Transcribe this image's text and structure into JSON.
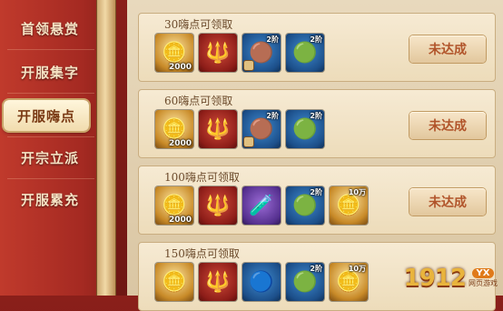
{
  "sidebar": {
    "items": [
      {
        "label": "首领悬赏",
        "active": false
      },
      {
        "label": "开服集字",
        "active": false
      },
      {
        "label": "开服嗨点",
        "active": true
      },
      {
        "label": "开宗立派",
        "active": false
      },
      {
        "label": "开服累充",
        "active": false
      }
    ]
  },
  "rewards": [
    {
      "title": "30嗨点可领取",
      "button": "未达成",
      "items": [
        {
          "icon": "gold-ingot-icon",
          "qty": "2000",
          "tier": ""
        },
        {
          "icon": "staff-icon",
          "qty": "",
          "tier": ""
        },
        {
          "icon": "bronze-orb-icon",
          "qty": "",
          "tier": "2阶"
        },
        {
          "icon": "green-orb-icon",
          "qty": "",
          "tier": "2阶"
        }
      ]
    },
    {
      "title": "60嗨点可领取",
      "button": "未达成",
      "items": [
        {
          "icon": "gold-ingot-icon",
          "qty": "2000",
          "tier": ""
        },
        {
          "icon": "staff-icon",
          "qty": "",
          "tier": ""
        },
        {
          "icon": "bronze-orb-icon",
          "qty": "",
          "tier": "2阶"
        },
        {
          "icon": "green-orb-icon",
          "qty": "",
          "tier": "2阶"
        }
      ]
    },
    {
      "title": "100嗨点可领取",
      "button": "未达成",
      "items": [
        {
          "icon": "gold-ingot-icon",
          "qty": "2000",
          "tier": ""
        },
        {
          "icon": "staff-icon",
          "qty": "",
          "tier": ""
        },
        {
          "icon": "potion-bottle-icon",
          "qty": "",
          "tier": ""
        },
        {
          "icon": "green-orb-icon",
          "qty": "",
          "tier": "2阶"
        },
        {
          "icon": "coins-icon",
          "qty": "",
          "tier": "10万"
        }
      ]
    },
    {
      "title": "150嗨点可领取",
      "button": "",
      "items": [
        {
          "icon": "gold-ingot-icon",
          "qty": "",
          "tier": ""
        },
        {
          "icon": "staff-icon",
          "qty": "",
          "tier": ""
        },
        {
          "icon": "blue-orb-icon",
          "qty": "",
          "tier": ""
        },
        {
          "icon": "green-orb-icon",
          "qty": "",
          "tier": "2阶"
        },
        {
          "icon": "coins-icon",
          "qty": "",
          "tier": "10万"
        }
      ]
    }
  ],
  "watermark": {
    "number": "1912",
    "badge": "YX",
    "site": "网页游戏"
  }
}
